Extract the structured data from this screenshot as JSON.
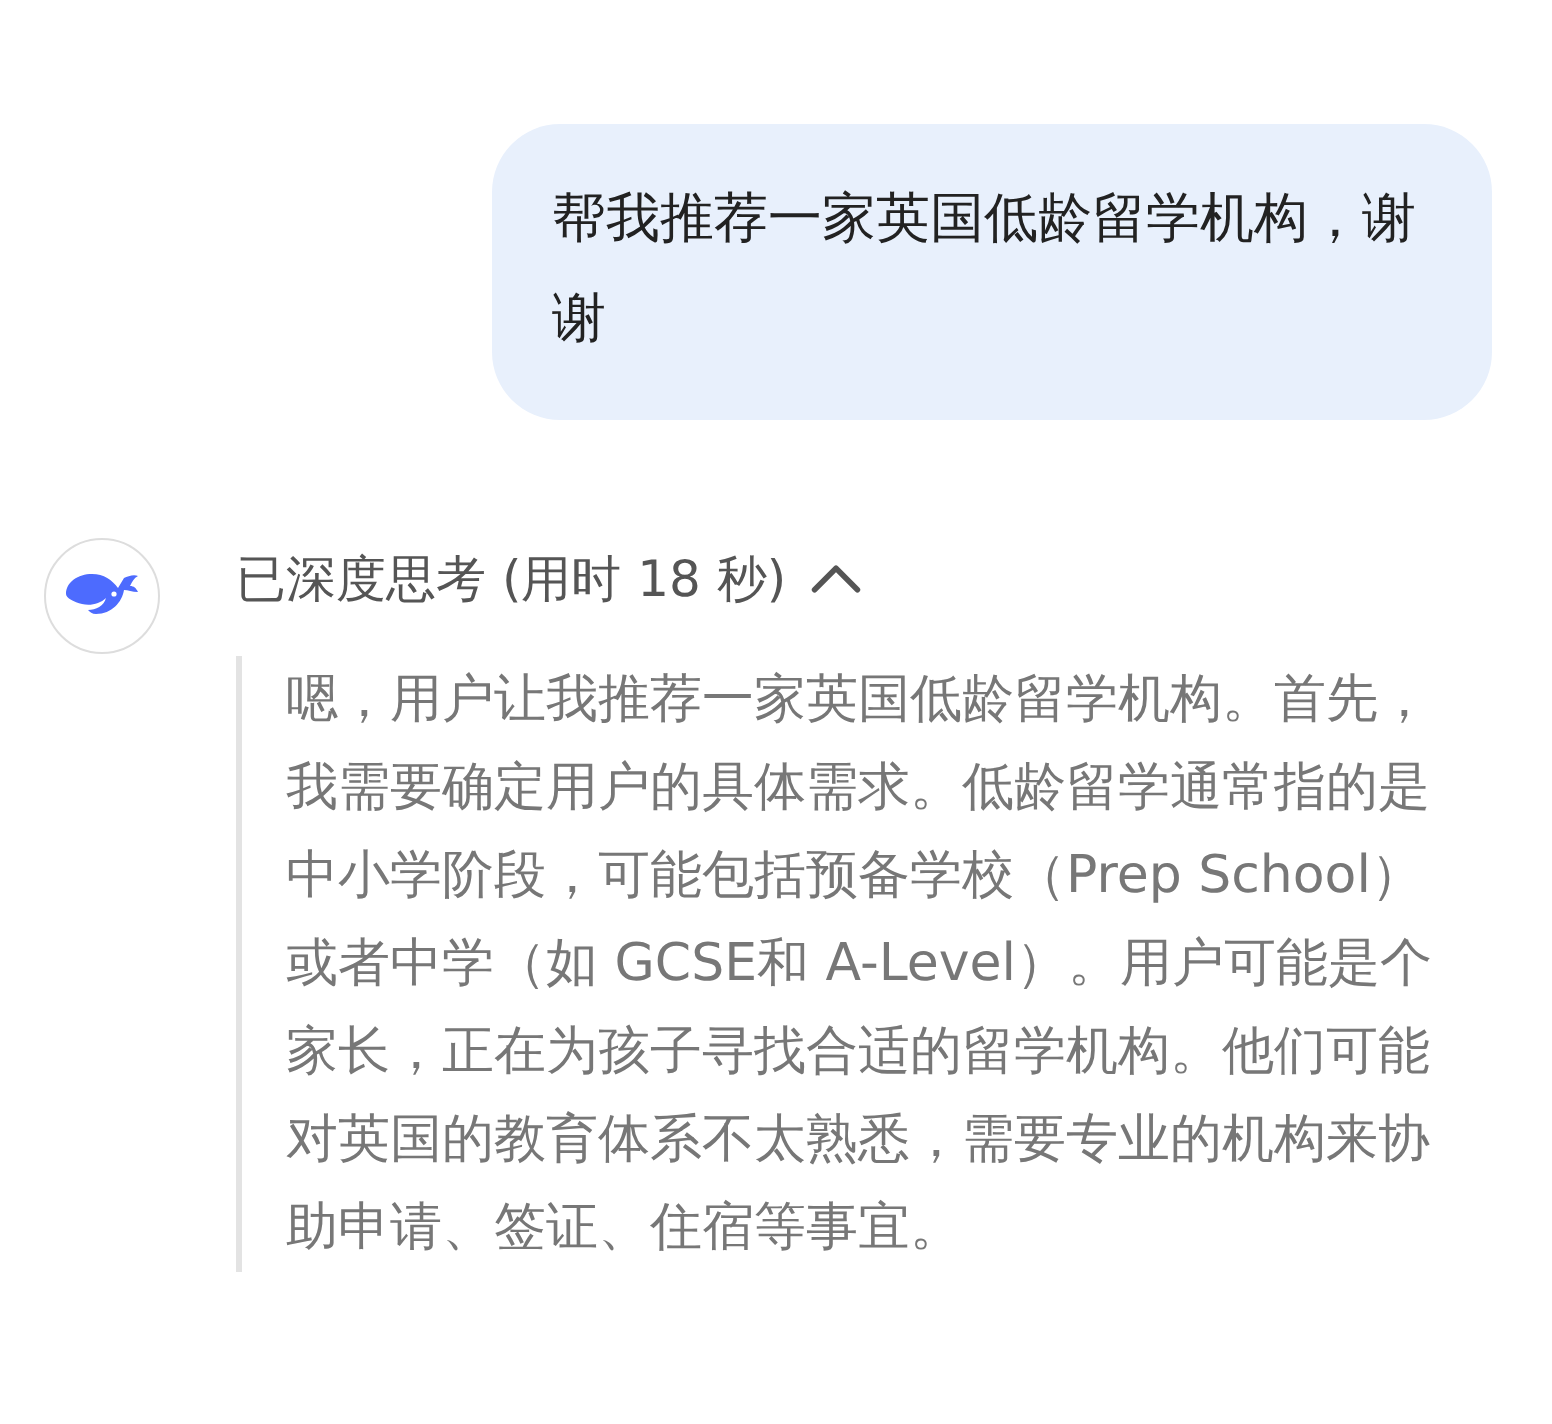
{
  "user_message": {
    "text": "帮我推荐一家英国低龄留学机构，谢谢"
  },
  "reply": {
    "thinking_header": "已深度思考 (用时 18 秒)",
    "expanded": true,
    "thinking": "嗯，用户让我推荐一家英国低龄留学机构。首先，我需要确定用户的具体需求。低龄留学通常指的是中小学阶段，可能包括预备学校（Prep School）或者中学（如 GCSE和 A-Level）。用户可能是个家长，正在为孩子寻找合适的留学机构。他们可能对英国的教育体系不太熟悉，需要专业的机构来协助申请、签证、住宿等事宜。"
  }
}
